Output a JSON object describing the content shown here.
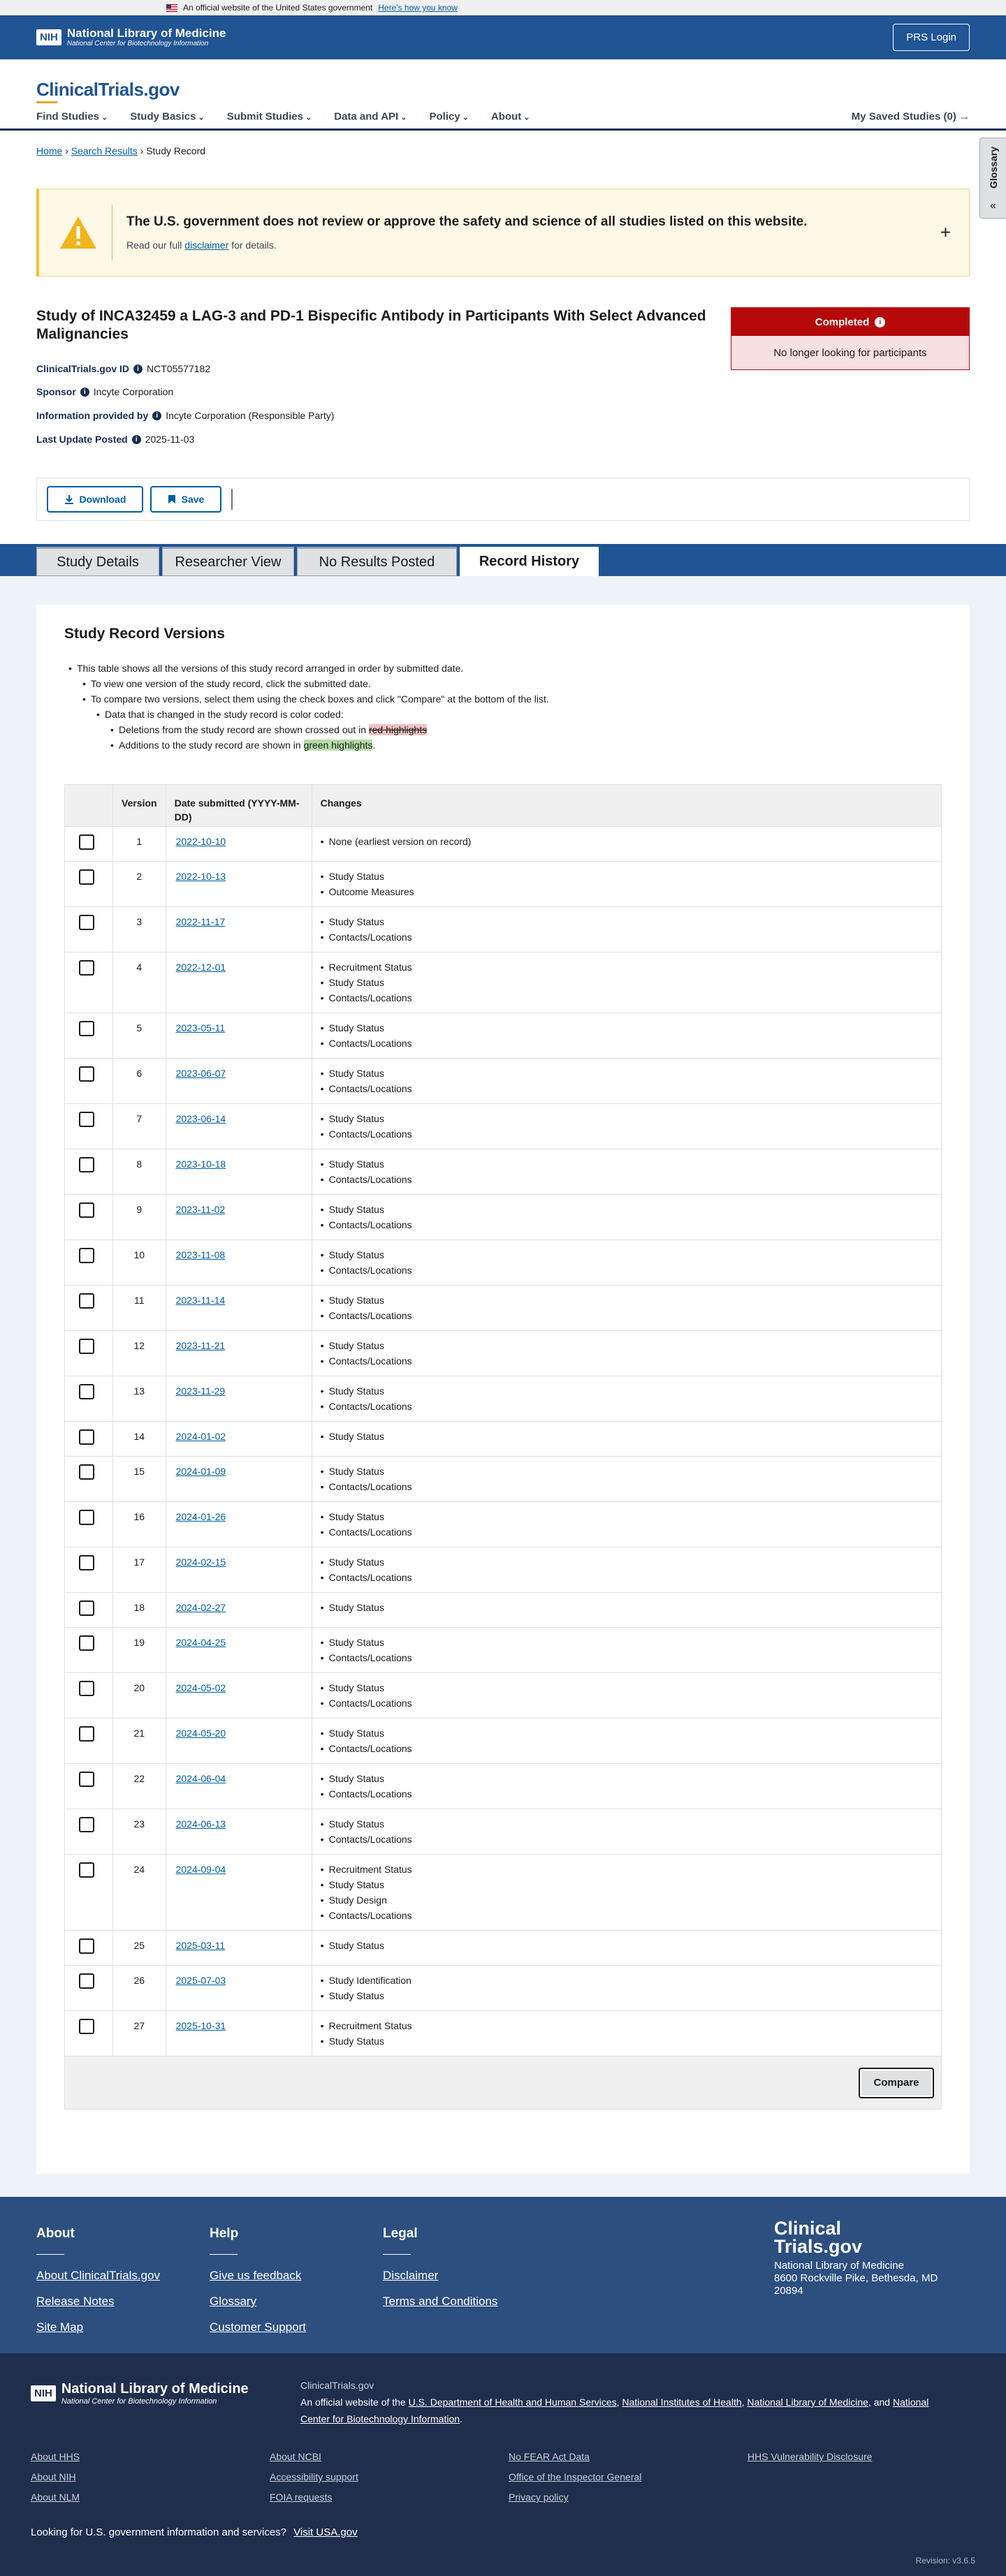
{
  "gov_banner": {
    "text": "An official website of the United States government",
    "link": "Here's how you know"
  },
  "nlm_header": {
    "nih": "NIH",
    "title": "National Library of Medicine",
    "subtitle": "National Center for Biotechnology Information",
    "prs_login": "PRS Login"
  },
  "site": {
    "logo": "ClinicalTrials.gov",
    "nav": [
      "Find Studies",
      "Study Basics",
      "Submit Studies",
      "Data and API",
      "Policy",
      "About"
    ],
    "saved": "My Saved Studies (0) →",
    "glossary": "Glossary"
  },
  "breadcrumb": {
    "home": "Home",
    "search": "Search Results",
    "current": "Study Record"
  },
  "alert": {
    "title": "The U.S. government does not review or approve the safety and science of all studies listed on this website.",
    "sub_before": "Read our full",
    "sub_link": "disclaimer",
    "sub_after": "for details."
  },
  "study": {
    "title": "Study of INCA32459 a LAG-3 and PD-1 Bispecific Antibody in Participants With Select Advanced Malignancies",
    "id_label": "ClinicalTrials.gov ID",
    "id": "NCT05577182",
    "sponsor_label": "Sponsor",
    "sponsor": "Incyte Corporation",
    "provided_label": "Information provided by",
    "provided": "Incyte Corporation (Responsible Party)",
    "updated_label": "Last Update Posted",
    "updated": "2025-11-03",
    "status": "Completed",
    "status_sub": "No longer looking for participants"
  },
  "toolbar": {
    "download": "Download",
    "save": "Save"
  },
  "tabs": [
    "Study Details",
    "Researcher View",
    "No Results Posted",
    "Record History"
  ],
  "versions": {
    "heading": "Study Record Versions",
    "intro1": "This table shows all the versions of this study record arranged in order by submitted date.",
    "intro2": "To view one version of the study record, click the submitted date.",
    "intro3": "To compare two versions, select them using the check boxes and click \"Compare\" at the bottom of the list.",
    "intro4": "Data that is changed in the study record is color coded:",
    "intro5_pre": "Deletions from the study record are shown crossed out in",
    "intro5_hl": "red highlights",
    "intro6_pre": "Additions to the study record are shown in",
    "intro6_hl": "green highlights",
    "col_version": "Version",
    "col_date": "Date submitted (YYYY-MM-DD)",
    "col_changes": "Changes",
    "compare": "Compare",
    "rows": [
      {
        "v": "1",
        "d": "2022-10-10",
        "c": [
          "None (earliest version on record)"
        ]
      },
      {
        "v": "2",
        "d": "2022-10-13",
        "c": [
          "Study Status",
          "Outcome Measures"
        ]
      },
      {
        "v": "3",
        "d": "2022-11-17",
        "c": [
          "Study Status",
          "Contacts/Locations"
        ]
      },
      {
        "v": "4",
        "d": "2022-12-01",
        "c": [
          "Recruitment Status",
          "Study Status",
          "Contacts/Locations"
        ]
      },
      {
        "v": "5",
        "d": "2023-05-11",
        "c": [
          "Study Status",
          "Contacts/Locations"
        ]
      },
      {
        "v": "6",
        "d": "2023-06-07",
        "c": [
          "Study Status",
          "Contacts/Locations"
        ]
      },
      {
        "v": "7",
        "d": "2023-06-14",
        "c": [
          "Study Status",
          "Contacts/Locations"
        ]
      },
      {
        "v": "8",
        "d": "2023-10-18",
        "c": [
          "Study Status",
          "Contacts/Locations"
        ]
      },
      {
        "v": "9",
        "d": "2023-11-02",
        "c": [
          "Study Status",
          "Contacts/Locations"
        ]
      },
      {
        "v": "10",
        "d": "2023-11-08",
        "c": [
          "Study Status",
          "Contacts/Locations"
        ]
      },
      {
        "v": "11",
        "d": "2023-11-14",
        "c": [
          "Study Status",
          "Contacts/Locations"
        ]
      },
      {
        "v": "12",
        "d": "2023-11-21",
        "c": [
          "Study Status",
          "Contacts/Locations"
        ]
      },
      {
        "v": "13",
        "d": "2023-11-29",
        "c": [
          "Study Status",
          "Contacts/Locations"
        ]
      },
      {
        "v": "14",
        "d": "2024-01-02",
        "c": [
          "Study Status"
        ]
      },
      {
        "v": "15",
        "d": "2024-01-09",
        "c": [
          "Study Status",
          "Contacts/Locations"
        ]
      },
      {
        "v": "16",
        "d": "2024-01-26",
        "c": [
          "Study Status",
          "Contacts/Locations"
        ]
      },
      {
        "v": "17",
        "d": "2024-02-15",
        "c": [
          "Study Status",
          "Contacts/Locations"
        ]
      },
      {
        "v": "18",
        "d": "2024-02-27",
        "c": [
          "Study Status"
        ]
      },
      {
        "v": "19",
        "d": "2024-04-25",
        "c": [
          "Study Status",
          "Contacts/Locations"
        ]
      },
      {
        "v": "20",
        "d": "2024-05-02",
        "c": [
          "Study Status",
          "Contacts/Locations"
        ]
      },
      {
        "v": "21",
        "d": "2024-05-20",
        "c": [
          "Study Status",
          "Contacts/Locations"
        ]
      },
      {
        "v": "22",
        "d": "2024-06-04",
        "c": [
          "Study Status",
          "Contacts/Locations"
        ]
      },
      {
        "v": "23",
        "d": "2024-06-13",
        "c": [
          "Study Status",
          "Contacts/Locations"
        ]
      },
      {
        "v": "24",
        "d": "2024-09-04",
        "c": [
          "Recruitment Status",
          "Study Status",
          "Study Design",
          "Contacts/Locations"
        ]
      },
      {
        "v": "25",
        "d": "2025-03-11",
        "c": [
          "Study Status"
        ]
      },
      {
        "v": "26",
        "d": "2025-07-03",
        "c": [
          "Study Identification",
          "Study Status"
        ]
      },
      {
        "v": "27",
        "d": "2025-10-31",
        "c": [
          "Recruitment Status",
          "Study Status"
        ]
      }
    ]
  },
  "footer": {
    "about_h": "About",
    "about_links": [
      "About ClinicalTrials.gov",
      "Release Notes",
      "Site Map"
    ],
    "help_h": "Help",
    "help_links": [
      "Give us feedback",
      "Glossary",
      "Customer Support"
    ],
    "legal_h": "Legal",
    "legal_links": [
      "Disclaimer",
      "Terms and Conditions"
    ],
    "logo_l1": "Clinical",
    "logo_l2": "Trials.gov",
    "addr1": "National Library of Medicine",
    "addr2": "8600 Rockville Pike, Bethesda, MD",
    "addr3": "20894"
  },
  "nlm_footer": {
    "ctg": "ClinicalTrials.gov",
    "official_pre": "An official website of the",
    "hhs": "U.S. Department of Health and Human Services",
    "nih": "National Institutes of Health",
    "nlm": "National Library of Medicine",
    "and": "and",
    "ncbi": "National Center for Biotechnology Information",
    "col1": [
      "About HHS",
      "About NIH",
      "About NLM"
    ],
    "col2": [
      "About NCBI",
      "Accessibility support",
      "FOIA requests"
    ],
    "col3": [
      "No FEAR Act Data",
      "Office of the Inspector General",
      "Privacy policy"
    ],
    "col4": [
      "HHS Vulnerability Disclosure"
    ],
    "usa_pre": "Looking for U.S. government information and services?",
    "usa_link": "Visit USA.gov",
    "revision": "Revision: v3.6.5"
  }
}
